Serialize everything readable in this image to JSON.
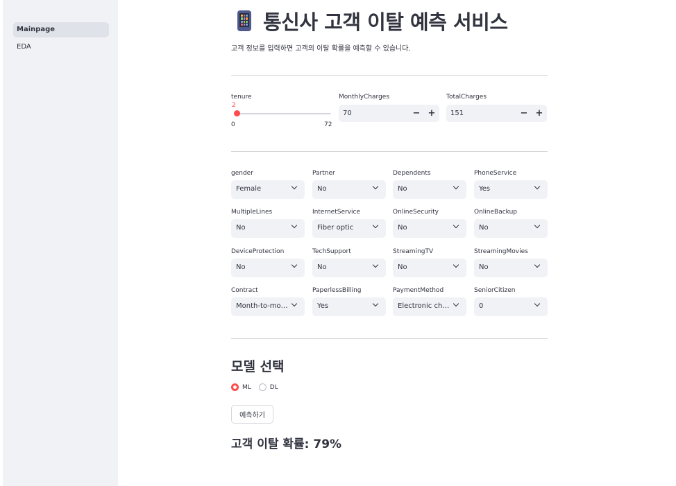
{
  "sidebar": {
    "items": [
      {
        "label": "Mainpage",
        "active": true
      },
      {
        "label": "EDA",
        "active": false
      }
    ]
  },
  "header": {
    "icon": "mobile-phone-icon",
    "title": "통신사 고객 이탈 예측 서비스",
    "subtitle": "고객 정보를 입력하면 고객의 이탈 확률을 예측할 수 있습니다."
  },
  "tenure": {
    "label": "tenure",
    "value": "2",
    "min": "0",
    "max": "72",
    "fraction": 0.0278
  },
  "monthly": {
    "label": "MonthlyCharges",
    "value": "70"
  },
  "total": {
    "label": "TotalCharges",
    "value": "151"
  },
  "stepper": {
    "minus": "−",
    "plus": "+"
  },
  "selects": [
    {
      "label": "gender",
      "value": "Female"
    },
    {
      "label": "Partner",
      "value": "No"
    },
    {
      "label": "Dependents",
      "value": "No"
    },
    {
      "label": "PhoneService",
      "value": "Yes"
    },
    {
      "label": "MultipleLines",
      "value": "No"
    },
    {
      "label": "InternetService",
      "value": "Fiber optic"
    },
    {
      "label": "OnlineSecurity",
      "value": "No"
    },
    {
      "label": "OnlineBackup",
      "value": "No"
    },
    {
      "label": "DeviceProtection",
      "value": "No"
    },
    {
      "label": "TechSupport",
      "value": "No"
    },
    {
      "label": "StreamingTV",
      "value": "No"
    },
    {
      "label": "StreamingMovies",
      "value": "No"
    },
    {
      "label": "Contract",
      "value": "Month-to-month"
    },
    {
      "label": "PaperlessBilling",
      "value": "Yes"
    },
    {
      "label": "PaymentMethod",
      "value": "Electronic check"
    },
    {
      "label": "SeniorCitizen",
      "value": "0"
    }
  ],
  "model": {
    "heading": "모델 선택",
    "options": [
      {
        "label": "ML",
        "selected": true
      },
      {
        "label": "DL",
        "selected": false
      }
    ],
    "button_label": "예측하기"
  },
  "result": {
    "text": "고객 이탈 확률: 79%"
  },
  "colors": {
    "accent": "#ff4b4b",
    "sidebar_bg": "#f0f2f6",
    "text": "#31333f"
  }
}
